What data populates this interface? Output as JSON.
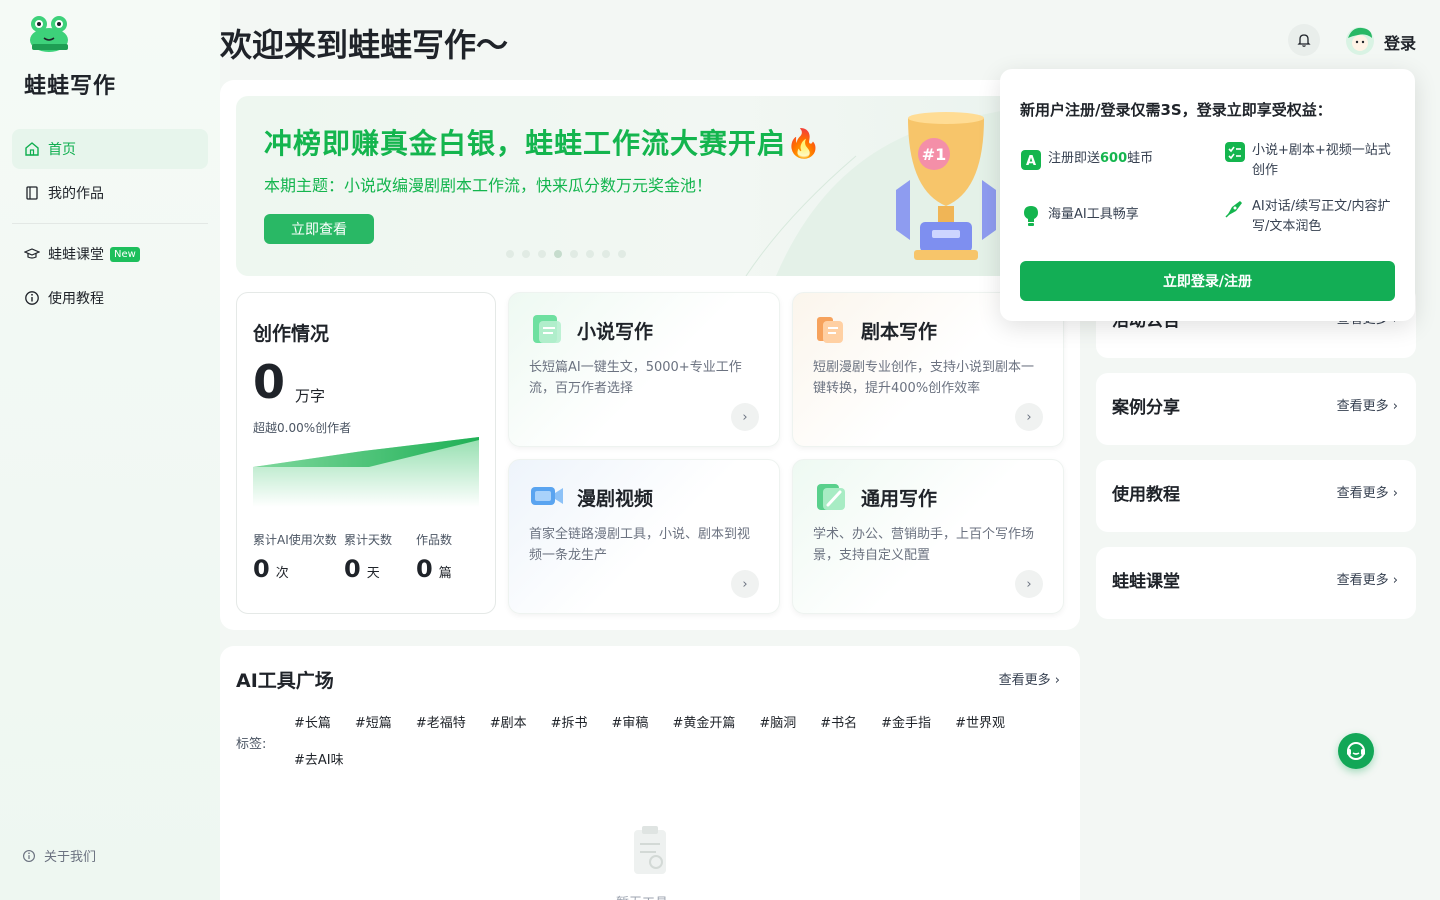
{
  "brand": {
    "name": "蛙蛙写作"
  },
  "nav": [
    {
      "label": "首页",
      "icon": "home-icon",
      "active": true
    },
    {
      "label": "我的作品",
      "icon": "book-icon"
    },
    {
      "label": "蛙蛙课堂",
      "icon": "graduation-cap-icon",
      "badge": "New"
    },
    {
      "label": "使用教程",
      "icon": "info-icon"
    }
  ],
  "about": "关于我们",
  "header": {
    "greeting": "欢迎来到蛙蛙写作～",
    "login": "登录"
  },
  "banner": {
    "title": "冲榜即赚真金白银，蛙蛙工作流大赛开启🔥",
    "subtitle": "本期主题：小说改编漫剧剧本工作流，快来瓜分数万元奖金池！",
    "button": "立即查看"
  },
  "stats": {
    "title": "创作情况",
    "words": "0",
    "words_unit": "万字",
    "exceed": "超越0.00%创作者",
    "items": [
      {
        "label": "累计AI使用次数",
        "value": "0",
        "unit": "次"
      },
      {
        "label": "累计天数",
        "value": "0",
        "unit": "天"
      },
      {
        "label": "作品数",
        "value": "0",
        "unit": "篇"
      }
    ]
  },
  "cards": [
    {
      "title": "小说写作",
      "desc": "长短篇AI一键生文，5000+专业工作流，百万作者选择",
      "icon": "novel-icon"
    },
    {
      "title": "剧本写作",
      "desc": "短剧漫剧专业创作，支持小说到剧本一键转换，提升400%创作效率",
      "icon": "script-icon"
    },
    {
      "title": "漫剧视频",
      "desc": "首家全链路漫剧工具，小说、剧本到视频一条龙生产",
      "icon": "video-camera-icon"
    },
    {
      "title": "通用写作",
      "desc": "学术、办公、营销助手，上百个写作场景，支持自定义配置",
      "icon": "pen-icon"
    }
  ],
  "side": [
    {
      "title": "活动公告",
      "more": "查看更多 ›"
    },
    {
      "title": "案例分享",
      "more": "查看更多 ›"
    },
    {
      "title": "使用教程",
      "more": "查看更多 ›"
    },
    {
      "title": "蛙蛙课堂",
      "more": "查看更多 ›"
    }
  ],
  "tools": {
    "title": "AI工具广场",
    "more": "查看更多 ›",
    "tags_label": "标签:",
    "tags": [
      "#长篇",
      "#短篇",
      "#老福特",
      "#剧本",
      "#拆书",
      "#审稿",
      "#黄金开篇",
      "#脑洞",
      "#书名",
      "#金手指",
      "#世界观",
      "#去AI味"
    ],
    "empty": "暂无工具"
  },
  "popover": {
    "title": "新用户注册/登录仅需3S，登录立即享受权益：",
    "f1_pre": "注册即送",
    "f1_num": "600",
    "f1_post": "蛙币",
    "f2": "小说+剧本+视频一站式创作",
    "f3": "海量AI工具畅享",
    "f4": "AI对话/续写正文/内容扩写/文本润色",
    "button": "立即登录/注册"
  },
  "colors": {
    "accent": "#14b54e",
    "button": "#13ae55"
  }
}
